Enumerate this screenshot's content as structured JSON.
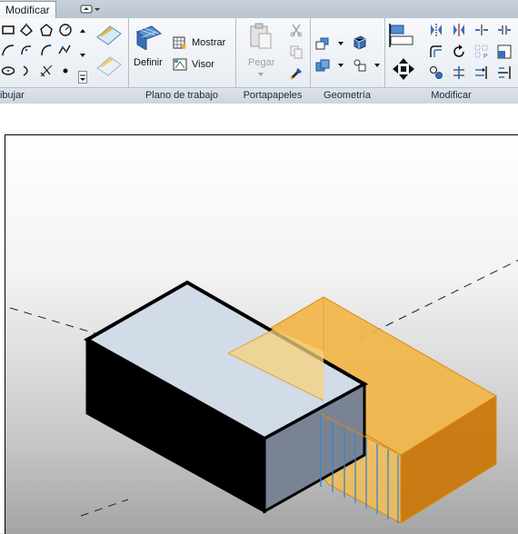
{
  "tabs": {
    "active": "Modificar"
  },
  "panels": {
    "dibujar": "Dibujar",
    "plano": "Plano de trabajo",
    "portapapeles": "Portapapeles",
    "geometria": "Geometría",
    "modificar": "Modificar"
  },
  "buttons": {
    "definir": "Definir",
    "mostrar": "Mostrar",
    "visor": "Visor",
    "pegar": "Pegar"
  },
  "colors": {
    "accent": "#f0a93a",
    "ribbon_bg": "#e5eaf0",
    "selection_outline": "#000000"
  },
  "icons": [
    "rectangle-icon",
    "polygon-icon",
    "circle-icon",
    "arc-icon",
    "spline-icon",
    "ellipse-icon",
    "pick-lines-icon",
    "point-icon",
    "work-plane-grid-icon",
    "paste-icon",
    "cut-icon",
    "copy-icon",
    "match-properties-icon",
    "join-icon",
    "cut-geometry-icon",
    "align-icon",
    "mirror-icon",
    "offset-icon",
    "rotate-icon",
    "move-icon",
    "array-icon",
    "scale-icon",
    "trim-icon",
    "split-icon",
    "pin-icon",
    "delete-icon"
  ]
}
